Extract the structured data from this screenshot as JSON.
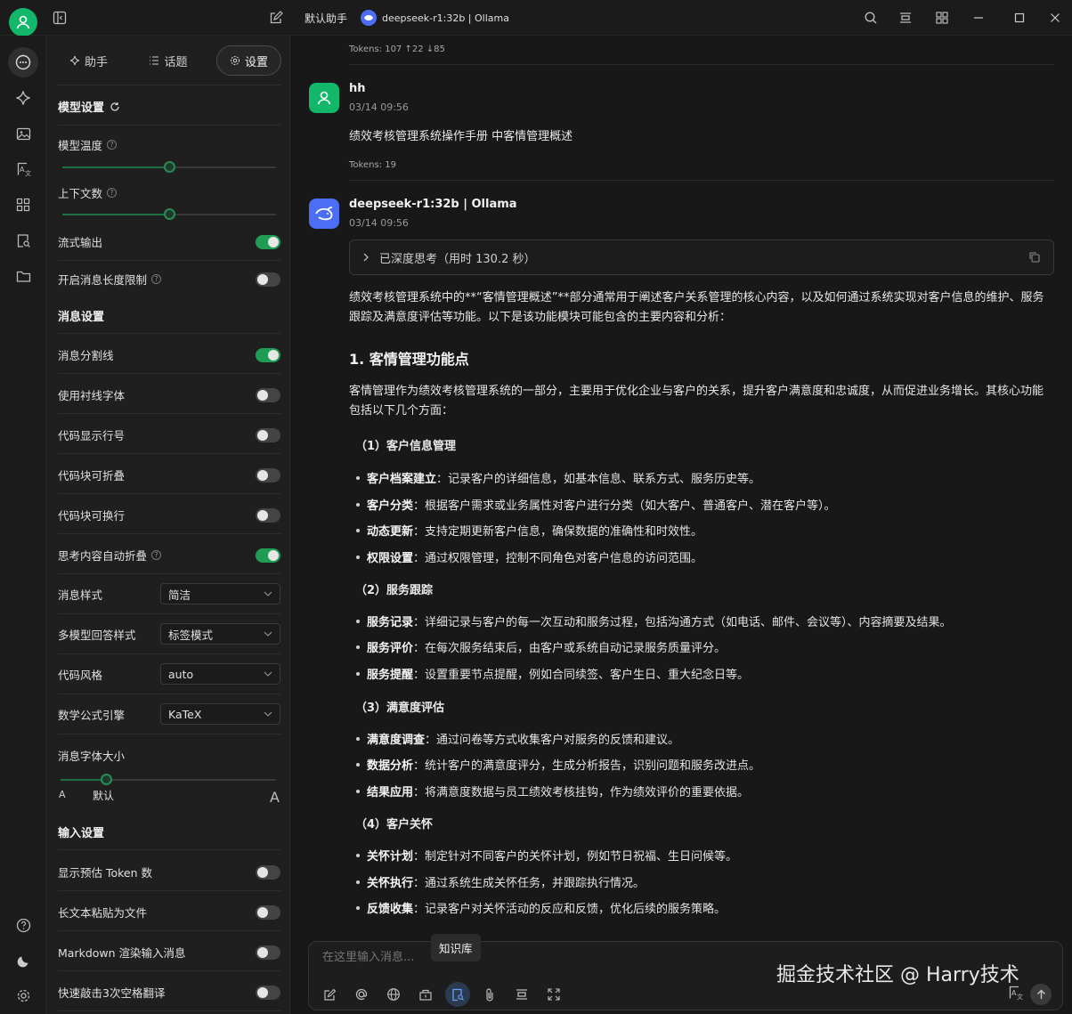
{
  "titlebar": {
    "assistant": "默认助手",
    "model": "deepseek-r1:32b | Ollama"
  },
  "tabs": [
    {
      "label": "助手"
    },
    {
      "label": "话题"
    },
    {
      "label": "设置"
    }
  ],
  "settings": {
    "model_section": "模型设置",
    "temperature": "模型温度",
    "temperature_value": 0.5,
    "context": "上下文数",
    "context_value": 0.5,
    "stream": "流式输出",
    "length_limit": "开启消息长度限制",
    "message_section": "消息设置",
    "msg_divider": "消息分割线",
    "serif_font": "使用衬线字体",
    "code_line_numbers": "代码显示行号",
    "code_collapse": "代码块可折叠",
    "code_wrap": "代码块可换行",
    "think_collapse": "思考内容自动折叠",
    "msg_style": "消息样式",
    "msg_style_value": "简洁",
    "multi_model": "多模型回答样式",
    "multi_model_value": "标签模式",
    "code_style": "代码风格",
    "code_style_value": "auto",
    "math_engine": "数学公式引擎",
    "math_engine_value": "KaTeX",
    "font_size": "消息字体大小",
    "font_size_value": 0.2,
    "font_small": "A",
    "font_default": "默认",
    "font_large": "A",
    "input_section": "输入设置",
    "show_tokens": "显示预估 Token 数",
    "paste_file": "长文本粘贴为文件",
    "markdown_input": "Markdown 渲染输入消息",
    "triple_space": "快速敲击3次空格翻译"
  },
  "chat": {
    "top_tokens": "Tokens: 107 ↑22 ↓85",
    "user_name": "hh",
    "user_time": "03/14 09:56",
    "user_msg": "绩效考核管理系统操作手册 中客情管理概述",
    "user_tokens": "Tokens: 19",
    "bot_name": "deepseek-r1:32b | Ollama",
    "bot_time": "03/14 09:56",
    "think_label": "已深度思考（用时 130.2 秒）",
    "intro": "绩效考核管理系统中的**“客情管理概述”**部分通常用于阐述客户关系管理的核心内容，以及如何通过系统实现对客户信息的维护、服务跟踪及满意度评估等功能。以下是该功能模块可能包含的主要内容和分析：",
    "h1": "1. 客情管理功能点",
    "h1_para": "客情管理作为绩效考核管理系统的一部分，主要用于优化企业与客户的关系，提升客户满意度和忠诚度，从而促进业务增长。其核心功能包括以下几个方面：",
    "s1": "（1）客户信息管理",
    "s1_items": [
      {
        "k": "客户档案建立",
        "v": "：记录客户的详细信息，如基本信息、联系方式、服务历史等。"
      },
      {
        "k": "客户分类",
        "v": "：根据客户需求或业务属性对客户进行分类（如大客户、普通客户、潜在客户等）。"
      },
      {
        "k": "动态更新",
        "v": "：支持定期更新客户信息，确保数据的准确性和时效性。"
      },
      {
        "k": "权限设置",
        "v": "：通过权限管理，控制不同角色对客户信息的访问范围。"
      }
    ],
    "s2": "（2）服务跟踪",
    "s2_items": [
      {
        "k": "服务记录",
        "v": "：详细记录与客户的每一次互动和服务过程，包括沟通方式（如电话、邮件、会议等）、内容摘要及结果。"
      },
      {
        "k": "服务评价",
        "v": "：在每次服务结束后，由客户或系统自动记录服务质量评分。"
      },
      {
        "k": "服务提醒",
        "v": "：设置重要节点提醒，例如合同续签、客户生日、重大纪念日等。"
      }
    ],
    "s3": "（3）满意度评估",
    "s3_items": [
      {
        "k": "满意度调查",
        "v": "：通过问卷等方式收集客户对服务的反馈和建议。"
      },
      {
        "k": "数据分析",
        "v": "：统计客户的满意度评分，生成分析报告，识别问题和服务改进点。"
      },
      {
        "k": "结果应用",
        "v": "：将满意度数据与员工绩效考核挂钩，作为绩效评价的重要依据。"
      }
    ],
    "s4": "（4）客户关怀",
    "s4_items": [
      {
        "k": "关怀计划",
        "v": "：制定针对不同客户的关怀计划，例如节日祝福、生日问候等。"
      },
      {
        "k": "关怀执行",
        "v": "：通过系统生成关怀任务，并跟踪执行情况。"
      },
      {
        "k": "反馈收集",
        "v": "：记录客户对关怀活动的反应和反馈，优化后续的服务策略。"
      }
    ]
  },
  "input": {
    "placeholder": "在这里输入消息...",
    "tooltip": "知识库",
    "watermark": "掘金技术社区 @ Harry技术"
  }
}
